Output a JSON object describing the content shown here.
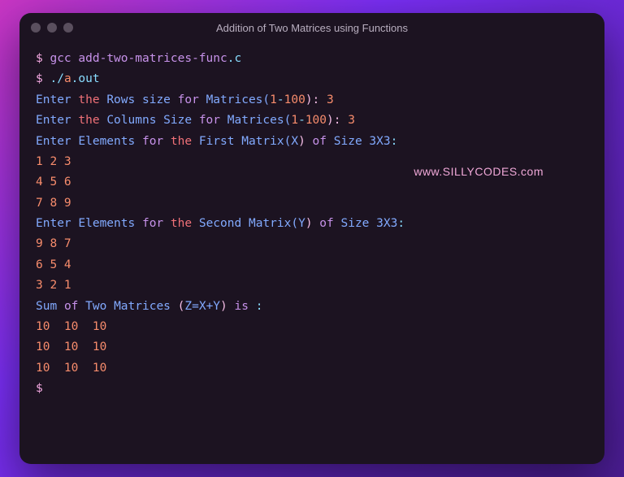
{
  "window": {
    "title": "Addition of Two Matrices using Functions"
  },
  "watermark": "www.SILLYCODES.com",
  "term": {
    "prompt": "$",
    "gcc": "gcc",
    "file_base": "add-two-matrices-func",
    "file_dot": ".",
    "file_ext": "c",
    "run_ds": "./",
    "run_a": "a",
    "run_dot": ".",
    "run_out": "out",
    "enter": "Enter",
    "the": "the",
    "rows": "Rows",
    "size_lower": "size",
    "size_cap": "Size",
    "for_kw": "for",
    "matrices_open": "Matrices(",
    "one": "1",
    "dash": "-",
    "hundred": "100",
    "close_colon": "):",
    "rows_val": "3",
    "columns": "Columns",
    "cols_val": "3",
    "elements": "Elements",
    "first": "First",
    "matrix_open": "Matrix(",
    "x_label": "X",
    "close": ")",
    "of_lower": "of",
    "size_word": "Size",
    "size_3x3": "3X3",
    "colon": ":",
    "m1r1": "1 2 3",
    "m1r2": "4 5 6",
    "m1r3": "7 8 9",
    "second": "Second",
    "y_label": "Y",
    "m2r1": "9 8 7",
    "m2r2": "6 5 4",
    "m2r3": "3 2 1",
    "sum": "Sum",
    "two": "Two",
    "matrices_word": "Matrices",
    "paren_open": "(",
    "zxy": "Z=X+Y",
    "paren_close": ")",
    "is_kw": "is",
    "trail_colon": ":",
    "res_r1": "10  10  10  ",
    "res_r2": "10  10  10  ",
    "res_r3": "10  10  10  "
  }
}
